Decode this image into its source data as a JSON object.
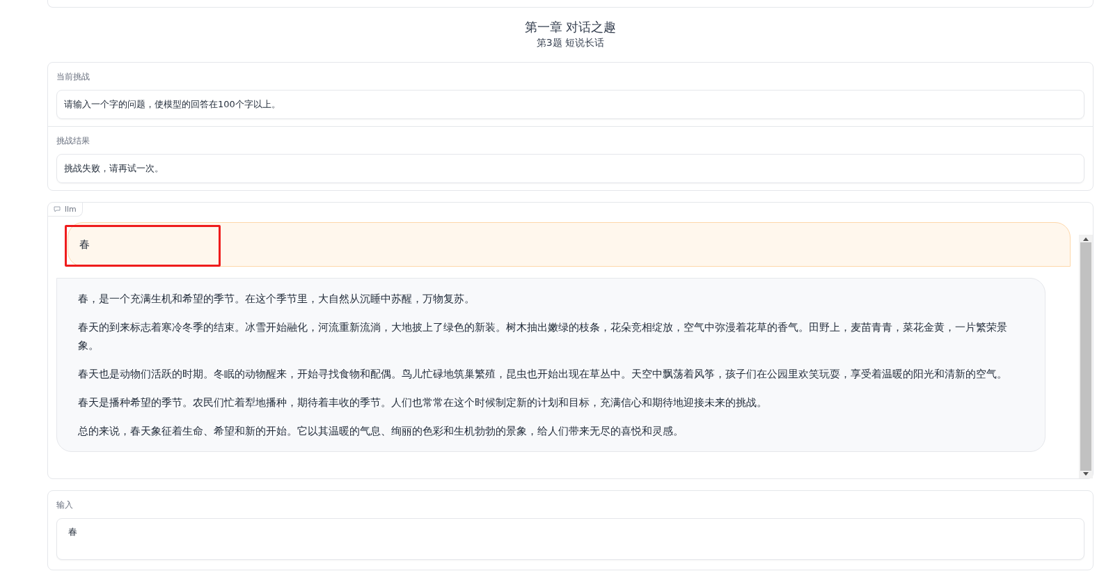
{
  "header": {
    "chapter": "第一章 对话之趣",
    "question": "第3题 短说长话"
  },
  "challenge": {
    "label": "当前挑战",
    "value": "请输入一个字的问题，使模型的回答在100个字以上。"
  },
  "result": {
    "label": "挑战结果",
    "value": "挑战失败，请再试一次。"
  },
  "chat": {
    "label": "llm",
    "messages": [
      {
        "kind": "user",
        "highlighted": true,
        "paragraphs": [
          "春"
        ]
      },
      {
        "kind": "bot",
        "highlighted": false,
        "paragraphs": [
          "春，是一个充满生机和希望的季节。在这个季节里，大自然从沉睡中苏醒，万物复苏。",
          "春天的到来标志着寒冷冬季的结束。冰雪开始融化，河流重新流淌，大地披上了绿色的新装。树木抽出嫩绿的枝条，花朵竞相绽放，空气中弥漫着花草的香气。田野上，麦苗青青，菜花金黄，一片繁荣景象。",
          "春天也是动物们活跃的时期。冬眠的动物醒来，开始寻找食物和配偶。鸟儿忙碌地筑巢繁殖，昆虫也开始出现在草丛中。天空中飘荡着风筝，孩子们在公园里欢笑玩耍，享受着温暖的阳光和清新的空气。",
          "春天是播种希望的季节。农民们忙着犁地播种，期待着丰收的季节。人们也常常在这个时候制定新的计划和目标，充满信心和期待地迎接未来的挑战。",
          "总的来说，春天象征着生命、希望和新的开始。它以其温暖的气息、绚丽的色彩和生机勃勃的景象，给人们带来无尽的喜悦和灵感。"
        ]
      }
    ]
  },
  "input": {
    "label": "输入",
    "value": "春"
  }
}
